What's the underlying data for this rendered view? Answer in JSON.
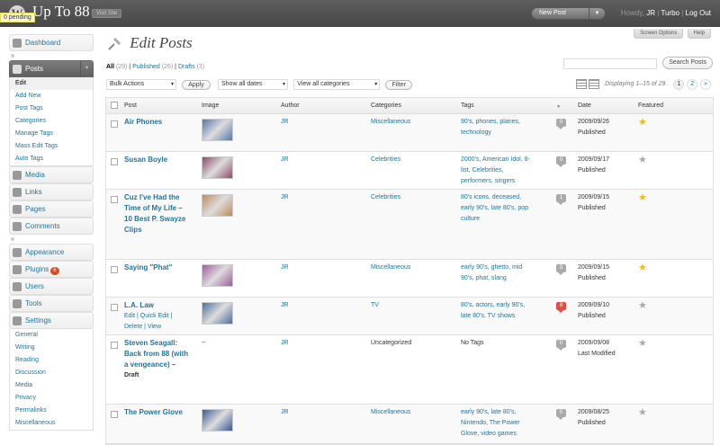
{
  "header": {
    "logo_letter": "W",
    "site_title": "Up To 88",
    "visit_site": "Visit Site",
    "pending": "0 pending",
    "new_post": "New Post",
    "howdy": "Howdy,",
    "user": "JR",
    "sep": "|",
    "turbo": "Turbo",
    "logout": "Log Out",
    "screen_options": "Screen Options",
    "help": "Help"
  },
  "menu": {
    "dashboard": "Dashboard",
    "posts": "Posts",
    "posts_sub": [
      "Edit",
      "Add New",
      "Post Tags",
      "Categories",
      "Manage Tags",
      "Mass Edit Tags",
      "Auto Tags"
    ],
    "media": "Media",
    "links": "Links",
    "pages": "Pages",
    "comments": "Comments",
    "appearance": "Appearance",
    "plugins": "Plugins",
    "plugins_badge": "6",
    "users": "Users",
    "tools": "Tools",
    "settings": "Settings",
    "settings_sub": [
      "General",
      "Writing",
      "Reading",
      "Discussion",
      "Media",
      "Privacy",
      "Permalinks",
      "Miscellaneous"
    ]
  },
  "page": {
    "title": "Edit Posts",
    "filter_all": "All",
    "filter_all_count": "(29)",
    "filter_published": "Published",
    "filter_published_count": "(26)",
    "filter_drafts": "Drafts",
    "filter_drafts_count": "(3)",
    "search_button": "Search Posts",
    "bulk_actions": "Bulk Actions",
    "apply": "Apply",
    "all_dates": "Show all dates",
    "all_categories": "View all categories",
    "filter": "Filter",
    "displaying": "Displaying 1–15 of 29",
    "pages": [
      "1",
      "2",
      "»"
    ]
  },
  "columns": {
    "post": "Post",
    "image": "Image",
    "author": "Author",
    "categories": "Categories",
    "tags": "Tags",
    "date": "Date",
    "featured": "Featured"
  },
  "posts": [
    {
      "title_lines": [
        "Air Phones"
      ],
      "author": "JR",
      "category": "Miscellaneous",
      "tags_lines": [
        "90's, phones, planes,",
        "technology"
      ],
      "comments": "0",
      "hot": false,
      "date": "2009/09/26",
      "status": "Published",
      "featured": true,
      "image": "#5577aa"
    },
    {
      "title_lines": [
        "Susan Boyle"
      ],
      "author": "JR",
      "category": "Celebrities",
      "tags_lines": [
        "2000's, American Idol, 8-",
        "list, Celebrities,",
        "performers, singers"
      ],
      "comments": "0",
      "hot": false,
      "date": "2009/09/17",
      "status": "Published",
      "featured": false,
      "image": "#8a4a6a"
    },
    {
      "title_lines": [
        "Cuz I've Had the",
        "Time of My Life –",
        "10 Best P. Swayze",
        "Clips"
      ],
      "author": "JR",
      "category": "Celebrities",
      "tags_lines": [
        "80's icons, deceased,",
        "early 90's, late 80's, pop",
        "culture"
      ],
      "comments": "1",
      "hot": false,
      "date": "2009/09/15",
      "status": "Published",
      "featured": true,
      "image": "#c08a5a"
    },
    {
      "title_lines": [
        "Saying \"Phat\""
      ],
      "author": "JR",
      "category": "Miscellaneous",
      "tags_lines": [
        "early 90's, ghetto, mid",
        "90's, phat, slang"
      ],
      "comments": "0",
      "hot": false,
      "date": "2009/09/15",
      "status": "Published",
      "featured": true,
      "image": "#a05aa0"
    },
    {
      "title_lines": [
        "L.A. Law"
      ],
      "row_actions": [
        "Edit",
        "Quick Edit",
        "Delete",
        "View"
      ],
      "author": "JR",
      "category": "TV",
      "tags_lines": [
        "80's, actors, early 90's,",
        "late 80's, TV shows"
      ],
      "comments": "8",
      "hot": true,
      "date": "2009/09/10",
      "status": "Published",
      "featured": false,
      "image": "#4a70a0"
    },
    {
      "title_lines": [
        "Steven Seagall:",
        "Back from 88 (with",
        "a vengeance) –"
      ],
      "draft": "Draft",
      "no_image": "--",
      "author": "JR",
      "category_plain": "Uncategorized",
      "tags_plain": "No Tags",
      "comments": "0",
      "hot": false,
      "date": "2009/09/08",
      "status": "Last Modified",
      "featured": false
    },
    {
      "title_lines": [
        "The Power Glove"
      ],
      "author": "JR",
      "category": "Miscellaneous",
      "tags_lines": [
        "early 90's, late 80's,",
        "Nintendo, The Power",
        "Glove, video games"
      ],
      "comments": "0",
      "hot": false,
      "date": "2009/08/25",
      "status": "Published",
      "featured": false,
      "image": "#3a5a90"
    }
  ]
}
